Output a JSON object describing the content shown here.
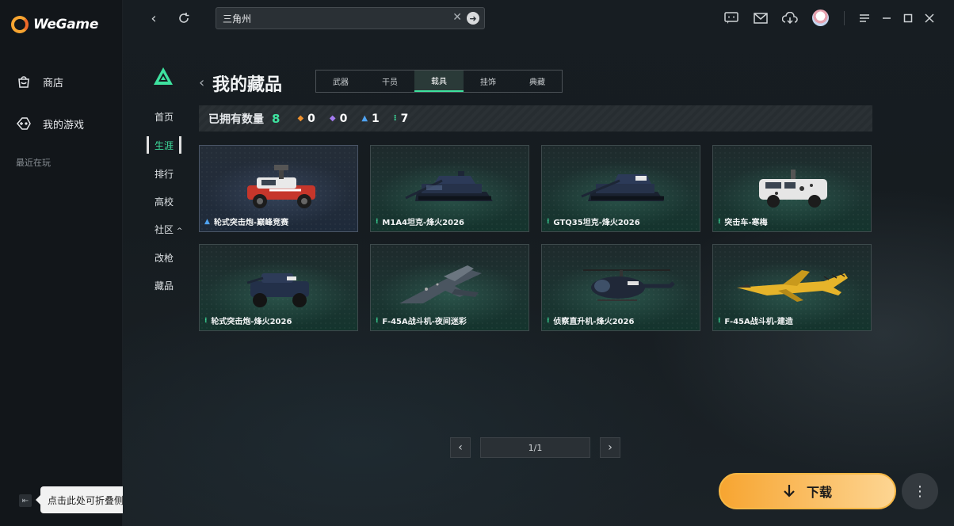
{
  "app": {
    "name": "WeGame"
  },
  "sidebar": {
    "items": [
      {
        "label": "商店",
        "icon": "shop-bag-icon"
      },
      {
        "label": "我的游戏",
        "icon": "gamepad-icon"
      }
    ],
    "recent_label": "最近在玩",
    "collapse_tooltip": "点击此处可折叠侧边栏"
  },
  "topbar": {
    "search_value": "三角州"
  },
  "game_nav": {
    "items": [
      "首页",
      "生涯",
      "排行",
      "高校",
      "社区",
      "改枪",
      "藏品"
    ],
    "active_index": 1,
    "accent_color": "#3ee29f"
  },
  "collection": {
    "title": "我的藏品",
    "tabs": [
      "武器",
      "干员",
      "载具",
      "挂饰",
      "典藏"
    ],
    "active_tab": 2,
    "stats": {
      "label": "已拥有数量",
      "total": "8",
      "counts": [
        {
          "icon": "orange-diamond-icon",
          "color": "#f0922e",
          "value": "0"
        },
        {
          "icon": "purple-diamond-icon",
          "color": "#a47bf0",
          "value": "0"
        },
        {
          "icon": "blue-rank-icon",
          "color": "#4fa3f2",
          "value": "1"
        },
        {
          "icon": "green-rank-icon",
          "color": "#3ee29f",
          "value": "7"
        }
      ]
    },
    "items": [
      {
        "name": "轮式突击炮-巅峰竞赛",
        "rarity": "blue"
      },
      {
        "name": "M1A4坦克-烽火2026",
        "rarity": "green"
      },
      {
        "name": "GTQ35坦克-烽火2026",
        "rarity": "green"
      },
      {
        "name": "突击车-寒梅",
        "rarity": "green"
      },
      {
        "name": "轮式突击炮-烽火2026",
        "rarity": "green"
      },
      {
        "name": "F-45A战斗机-夜间迷彩",
        "rarity": "green"
      },
      {
        "name": "侦察直升机-烽火2026",
        "rarity": "green"
      },
      {
        "name": "F-45A战斗机-建造",
        "rarity": "green"
      }
    ]
  },
  "pagination": {
    "page": "1/1"
  },
  "actions": {
    "download_label": "下载"
  }
}
